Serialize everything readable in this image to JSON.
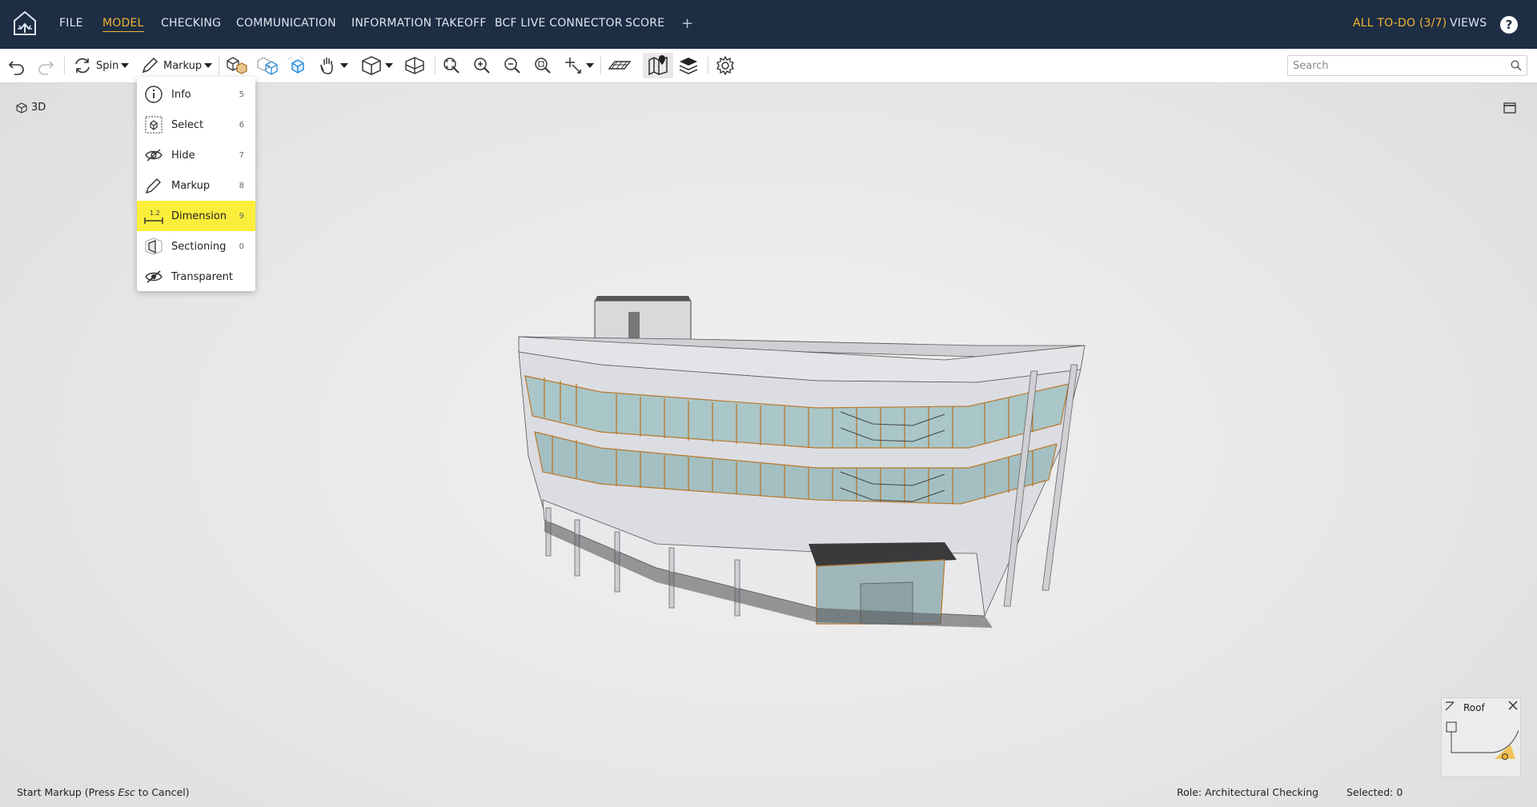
{
  "nav": {
    "items": [
      "FILE",
      "MODEL",
      "CHECKING",
      "COMMUNICATION",
      "INFORMATION TAKEOFF",
      "BCF LIVE CONNECTOR",
      "SCORE"
    ],
    "add": "+",
    "todo": "ALL TO-DO (3/7)",
    "views": "VIEWS",
    "help": "?"
  },
  "toolbar": {
    "spin_label": "Spin",
    "markup_label": "Markup",
    "search_placeholder": "Search"
  },
  "viewport": {
    "mode_label": "3D"
  },
  "menu": {
    "items": [
      {
        "label": "Info",
        "key": "5",
        "icon": "info-icon"
      },
      {
        "label": "Select",
        "key": "6",
        "icon": "select-icon"
      },
      {
        "label": "Hide",
        "key": "7",
        "icon": "hide-icon"
      },
      {
        "label": "Markup",
        "key": "8",
        "icon": "pencil-icon"
      },
      {
        "label": "Dimension",
        "key": "9",
        "icon": "dimension-icon"
      },
      {
        "label": "Sectioning",
        "key": "0",
        "icon": "section-box-icon"
      },
      {
        "label": "Transparent",
        "key": "",
        "icon": "transparent-eye-icon"
      }
    ],
    "highlighted": "Dimension"
  },
  "minimap": {
    "title": "Roof"
  },
  "status": {
    "hint_prefix": "Start Markup (Press ",
    "hint_key": "Esc",
    "hint_suffix": " to Cancel)",
    "role": "Role: Architectural Checking",
    "selected": "Selected: 0"
  },
  "colors": {
    "nav_bg": "#1d2d44",
    "accent": "#f2b431",
    "highlight": "#fbee3b"
  }
}
